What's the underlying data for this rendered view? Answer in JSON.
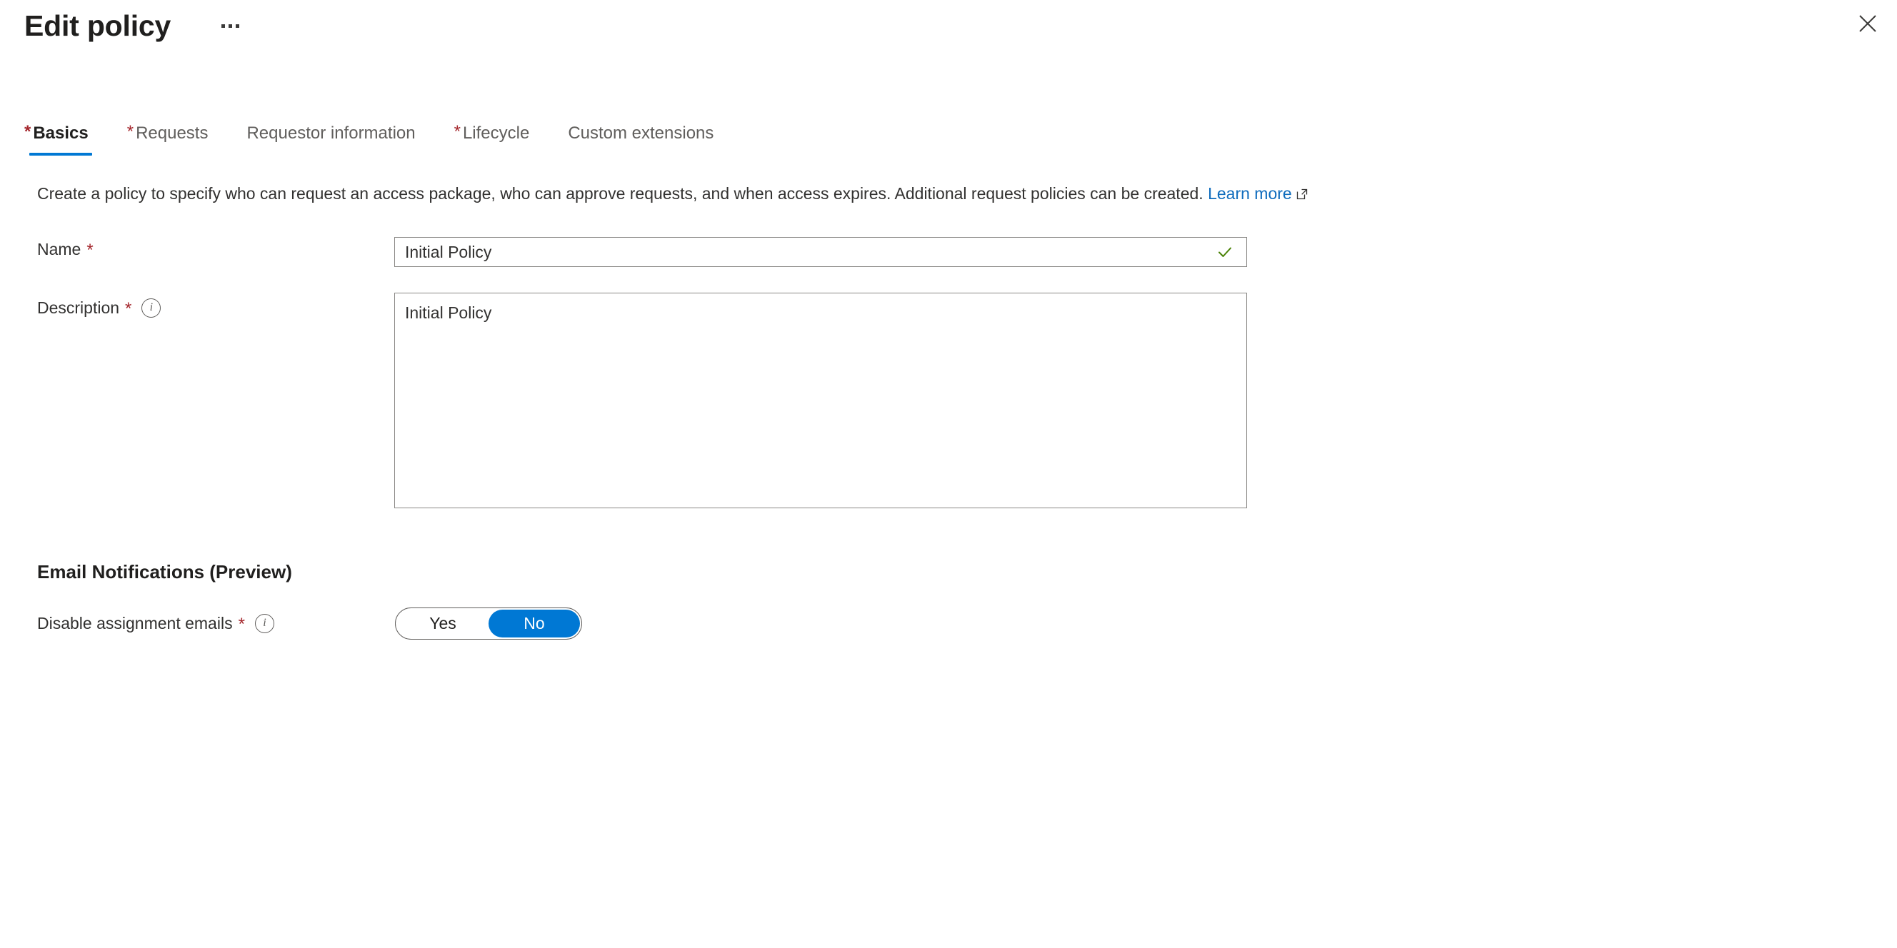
{
  "header": {
    "title": "Edit policy",
    "more_menu_icon": "ellipsis-icon",
    "close_icon": "close-icon"
  },
  "tabs": [
    {
      "label": "Basics",
      "required": true,
      "active": true
    },
    {
      "label": "Requests",
      "required": true,
      "active": false
    },
    {
      "label": "Requestor information",
      "required": false,
      "active": false
    },
    {
      "label": "Lifecycle",
      "required": true,
      "active": false
    },
    {
      "label": "Custom extensions",
      "required": false,
      "active": false
    }
  ],
  "intro": {
    "text": "Create a policy to specify who can request an access package, who can approve requests, and when access expires. Additional request policies can be created.",
    "link_label": "Learn more",
    "link_icon": "external-link-icon"
  },
  "form": {
    "name": {
      "label": "Name",
      "required_marker": "*",
      "value": "Initial Policy",
      "placeholder": "",
      "validation_icon": "checkmark-icon",
      "validation_color": "#498205"
    },
    "description": {
      "label": "Description",
      "required_marker": "*",
      "info_icon": "info-icon",
      "value": "Initial Policy",
      "placeholder": ""
    }
  },
  "email_notifications": {
    "heading": "Email Notifications (Preview)",
    "disable_assignment_emails": {
      "label": "Disable assignment emails",
      "required_marker": "*",
      "info_icon": "info-icon",
      "options": [
        {
          "label": "Yes",
          "selected": false
        },
        {
          "label": "No",
          "selected": true
        }
      ]
    }
  },
  "colors": {
    "accent": "#0078d4",
    "link": "#0f6cbd",
    "required": "#a4262c",
    "success": "#498205"
  }
}
